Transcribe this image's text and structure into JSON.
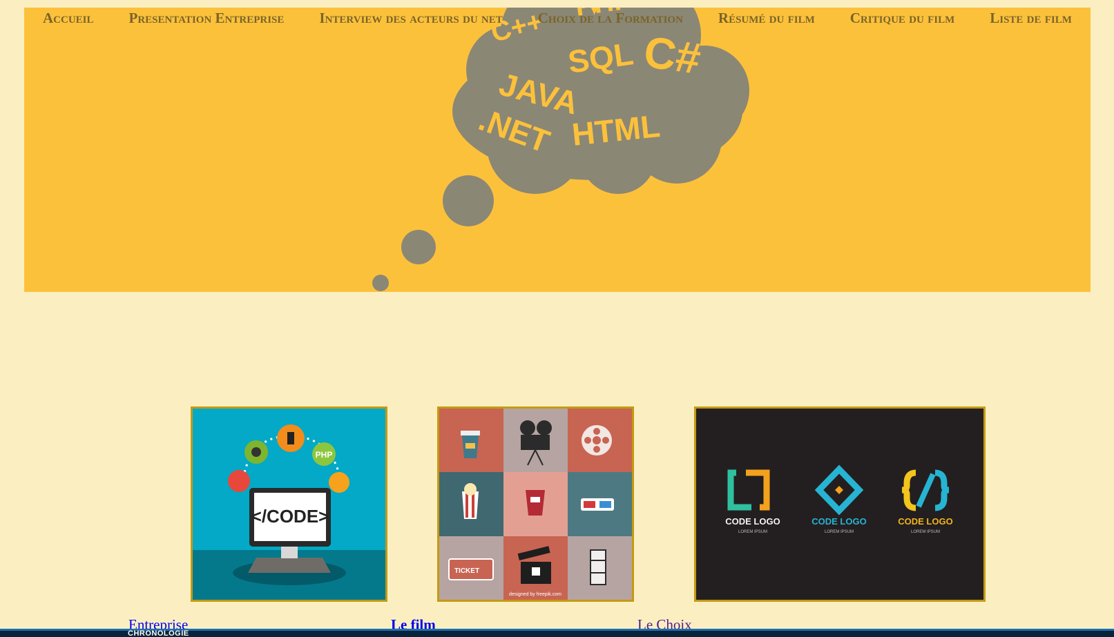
{
  "nav": {
    "items": [
      {
        "label": "Accueil"
      },
      {
        "label": "Presentation Entreprise"
      },
      {
        "label": "Interview des acteurs du net"
      },
      {
        "label": "Choix de la Formation"
      },
      {
        "label": "Résumé du film"
      },
      {
        "label": "Critique du film"
      },
      {
        "label": "Liste de film"
      }
    ]
  },
  "banner": {
    "cloud_words": [
      "C++",
      "PHP",
      "SQL",
      "C#",
      "JAVA",
      ".NET",
      "HTML"
    ],
    "colors": {
      "background": "#fcc13b",
      "cloud": "#8b8775"
    }
  },
  "cards": {
    "code": {
      "screen_text": "</CODE>",
      "bubble_label": "PHP"
    },
    "film": {
      "ticket_text": "TICKET",
      "credit": "designed by freepik.com"
    },
    "logos": {
      "logo_text": "CODE LOGO",
      "logo_sub": "LOREM IPSUM"
    }
  },
  "captions": {
    "entreprise": "Entreprise",
    "film": "Le film",
    "choix": "Le Choix"
  },
  "bottombar": {
    "text": "CHRONOLOGIE"
  },
  "colors": {
    "page_bg": "#fbefc2",
    "nav_text": "#7a6428",
    "card_border": "#c49a12",
    "link": "#0000ee",
    "visited": "#551a8b"
  }
}
